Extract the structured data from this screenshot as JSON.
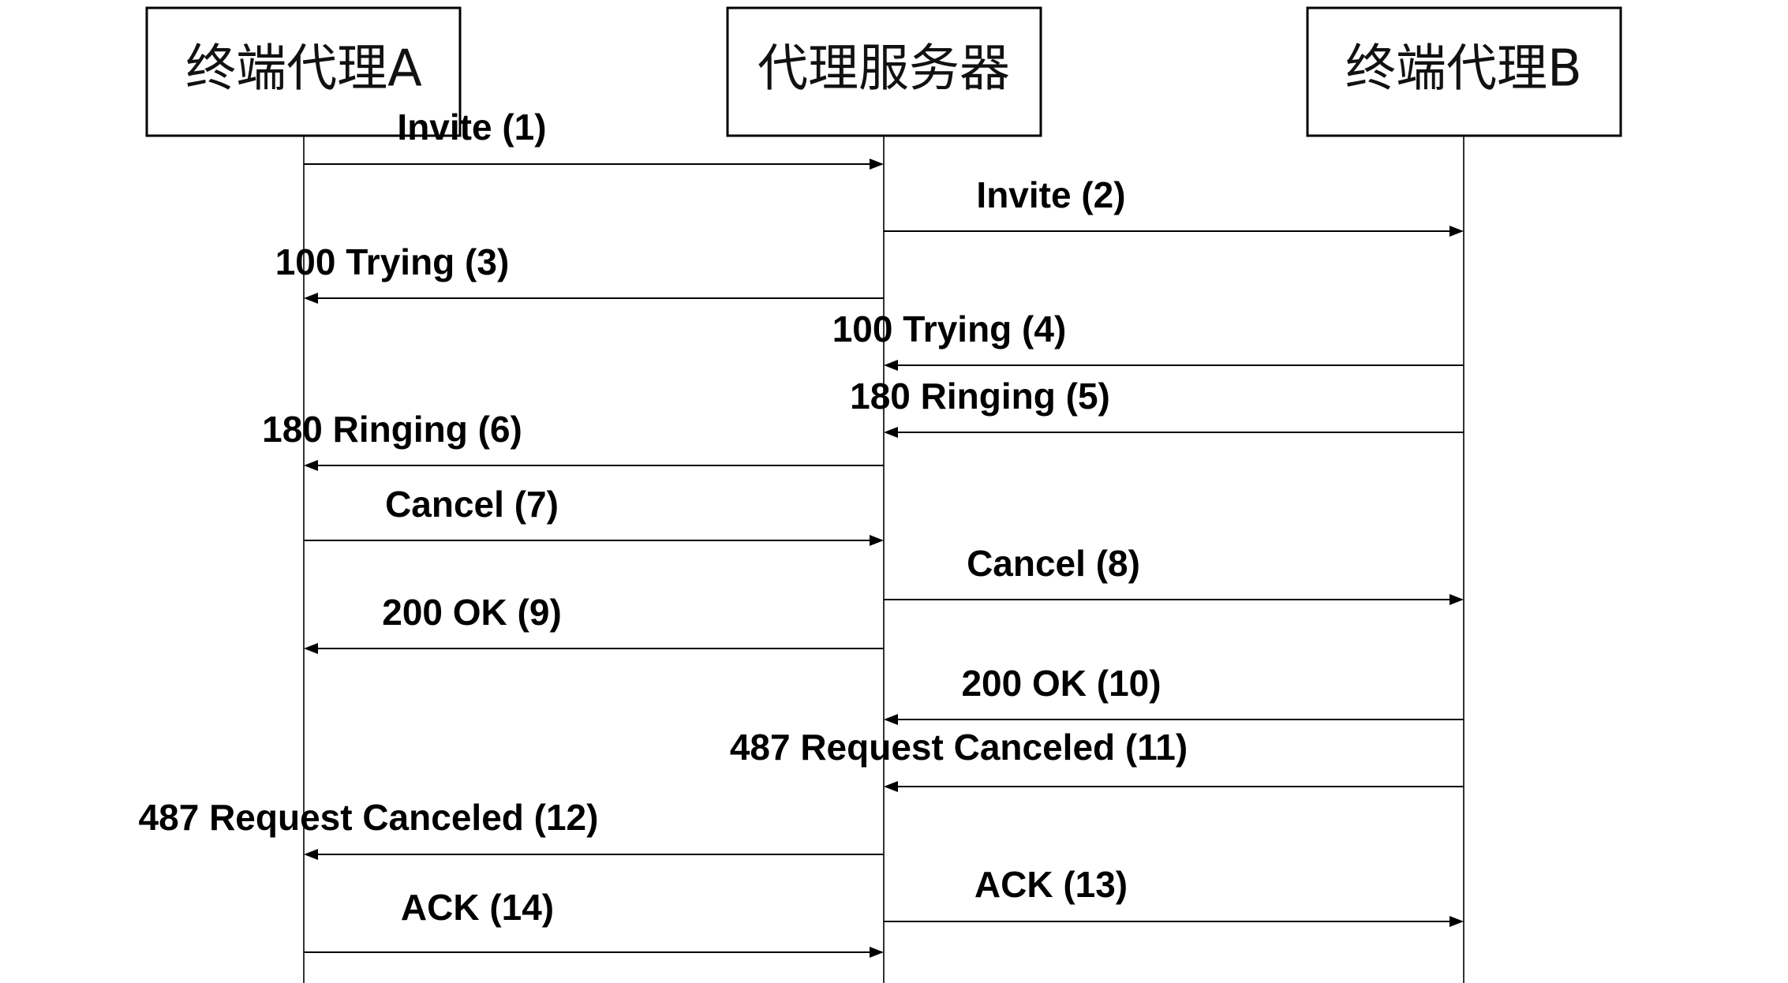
{
  "participants": [
    {
      "id": "A",
      "label": "终端代理A"
    },
    {
      "id": "P",
      "label": "代理服务器"
    },
    {
      "id": "B",
      "label": "终端代理B"
    }
  ],
  "messages": [
    {
      "label": "Invite (1)",
      "from": "A",
      "to": "P"
    },
    {
      "label": "Invite (2)",
      "from": "P",
      "to": "B"
    },
    {
      "label": "100 Trying (3)",
      "from": "P",
      "to": "A"
    },
    {
      "label": "100 Trying (4)",
      "from": "B",
      "to": "P"
    },
    {
      "label": "180 Ringing (5)",
      "from": "B",
      "to": "P"
    },
    {
      "label": "180 Ringing (6)",
      "from": "P",
      "to": "A"
    },
    {
      "label": "Cancel (7)",
      "from": "A",
      "to": "P"
    },
    {
      "label": "Cancel (8)",
      "from": "P",
      "to": "B"
    },
    {
      "label": "200 OK (9)",
      "from": "P",
      "to": "A"
    },
    {
      "label": "200 OK (10)",
      "from": "B",
      "to": "P"
    },
    {
      "label": "487 Request Canceled (11)",
      "from": "B",
      "to": "P"
    },
    {
      "label": "487 Request Canceled (12)",
      "from": "P",
      "to": "A"
    },
    {
      "label": "ACK (13)",
      "from": "P",
      "to": "B"
    },
    {
      "label": "ACK (14)",
      "from": "A",
      "to": "P"
    }
  ],
  "colors": {
    "line": "#000000",
    "background": "#ffffff"
  }
}
